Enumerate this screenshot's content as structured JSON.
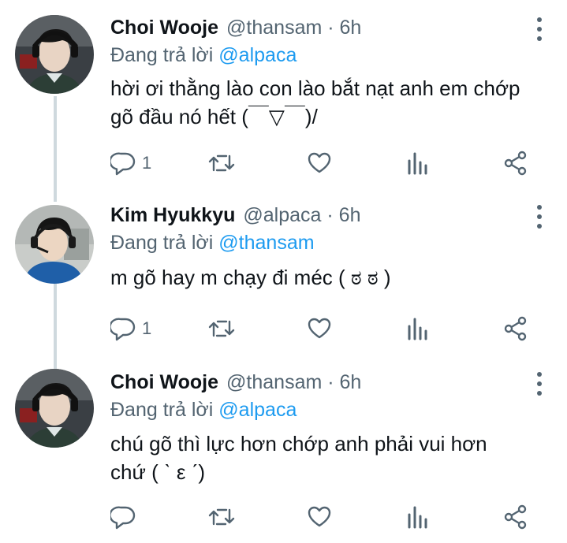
{
  "colors": {
    "text": "#0f1419",
    "secondary": "#536471",
    "link": "#1d9bf0",
    "thread_line": "#cfd9de"
  },
  "tweets": [
    {
      "name": "Choi Wooje",
      "handle": "@thansam",
      "time": "6h",
      "reply_prefix": "Đang trả lời",
      "reply_handle": "@alpaca",
      "text": "hời ơi thằng lào con lào bắt nạt anh em chớp\ngõ đầu nó hết (￣▽￣)/",
      "reply_count": "1",
      "icons": [
        "reply-icon",
        "retweet-icon",
        "like-icon",
        "views-icon",
        "share-icon"
      ]
    },
    {
      "name": "Kim Hyukkyu",
      "handle": "@alpaca",
      "time": "6h",
      "reply_prefix": "Đang trả lời",
      "reply_handle": "@thansam",
      "text": "m gõ hay m chạy đi méc ( ಠ ಠ )",
      "reply_count": "1",
      "icons": [
        "reply-icon",
        "retweet-icon",
        "like-icon",
        "views-icon",
        "share-icon"
      ]
    },
    {
      "name": "Choi Wooje",
      "handle": "@thansam",
      "time": "6h",
      "reply_prefix": "Đang trả lời",
      "reply_handle": "@alpaca",
      "text": "chú gõ thì lực hơn chớp anh phải vui hơn\nchứ ( ˋ ε ˊ)",
      "reply_count": "",
      "icons": [
        "reply-icon",
        "retweet-icon",
        "like-icon",
        "views-icon",
        "share-icon"
      ]
    }
  ]
}
